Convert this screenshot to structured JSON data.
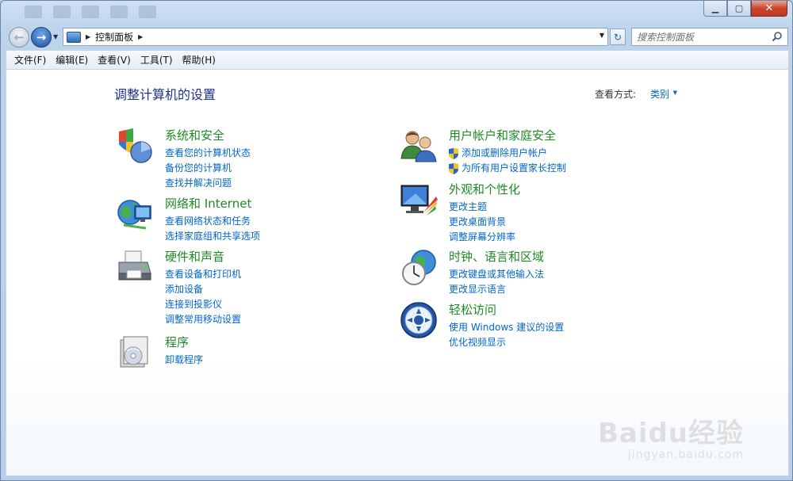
{
  "address": {
    "breadcrumb": "控制面板"
  },
  "search": {
    "placeholder": "搜索控制面板"
  },
  "menu": [
    "文件(F)",
    "编辑(E)",
    "查看(V)",
    "工具(T)",
    "帮助(H)"
  ],
  "page": {
    "title": "调整计算机的设置",
    "view_by_label": "查看方式:",
    "view_by_value": "类别"
  },
  "categories": {
    "system": {
      "title": "系统和安全",
      "links": [
        "查看您的计算机状态",
        "备份您的计算机",
        "查找并解决问题"
      ]
    },
    "network": {
      "title": "网络和 Internet",
      "links": [
        "查看网络状态和任务",
        "选择家庭组和共享选项"
      ]
    },
    "hardware": {
      "title": "硬件和声音",
      "links": [
        "查看设备和打印机",
        "添加设备",
        "连接到投影仪",
        "调整常用移动设置"
      ]
    },
    "programs": {
      "title": "程序",
      "links": [
        "卸载程序"
      ]
    },
    "users": {
      "title": "用户帐户和家庭安全",
      "links": [
        "添加或删除用户帐户",
        "为所有用户设置家长控制"
      ]
    },
    "appearance": {
      "title": "外观和个性化",
      "links": [
        "更改主题",
        "更改桌面背景",
        "调整屏幕分辨率"
      ]
    },
    "clock": {
      "title": "时钟、语言和区域",
      "links": [
        "更改键盘或其他输入法",
        "更改显示语言"
      ]
    },
    "ease": {
      "title": "轻松访问",
      "links": [
        "使用 Windows 建议的设置",
        "优化视频显示"
      ]
    }
  },
  "watermark": {
    "logo": "Baidu经验",
    "url": "jingyan.baidu.com"
  },
  "colors": {
    "category_title": "#1e8a25",
    "link": "#0066cc",
    "heading": "#1e3287",
    "close_button": "#c9452c"
  }
}
